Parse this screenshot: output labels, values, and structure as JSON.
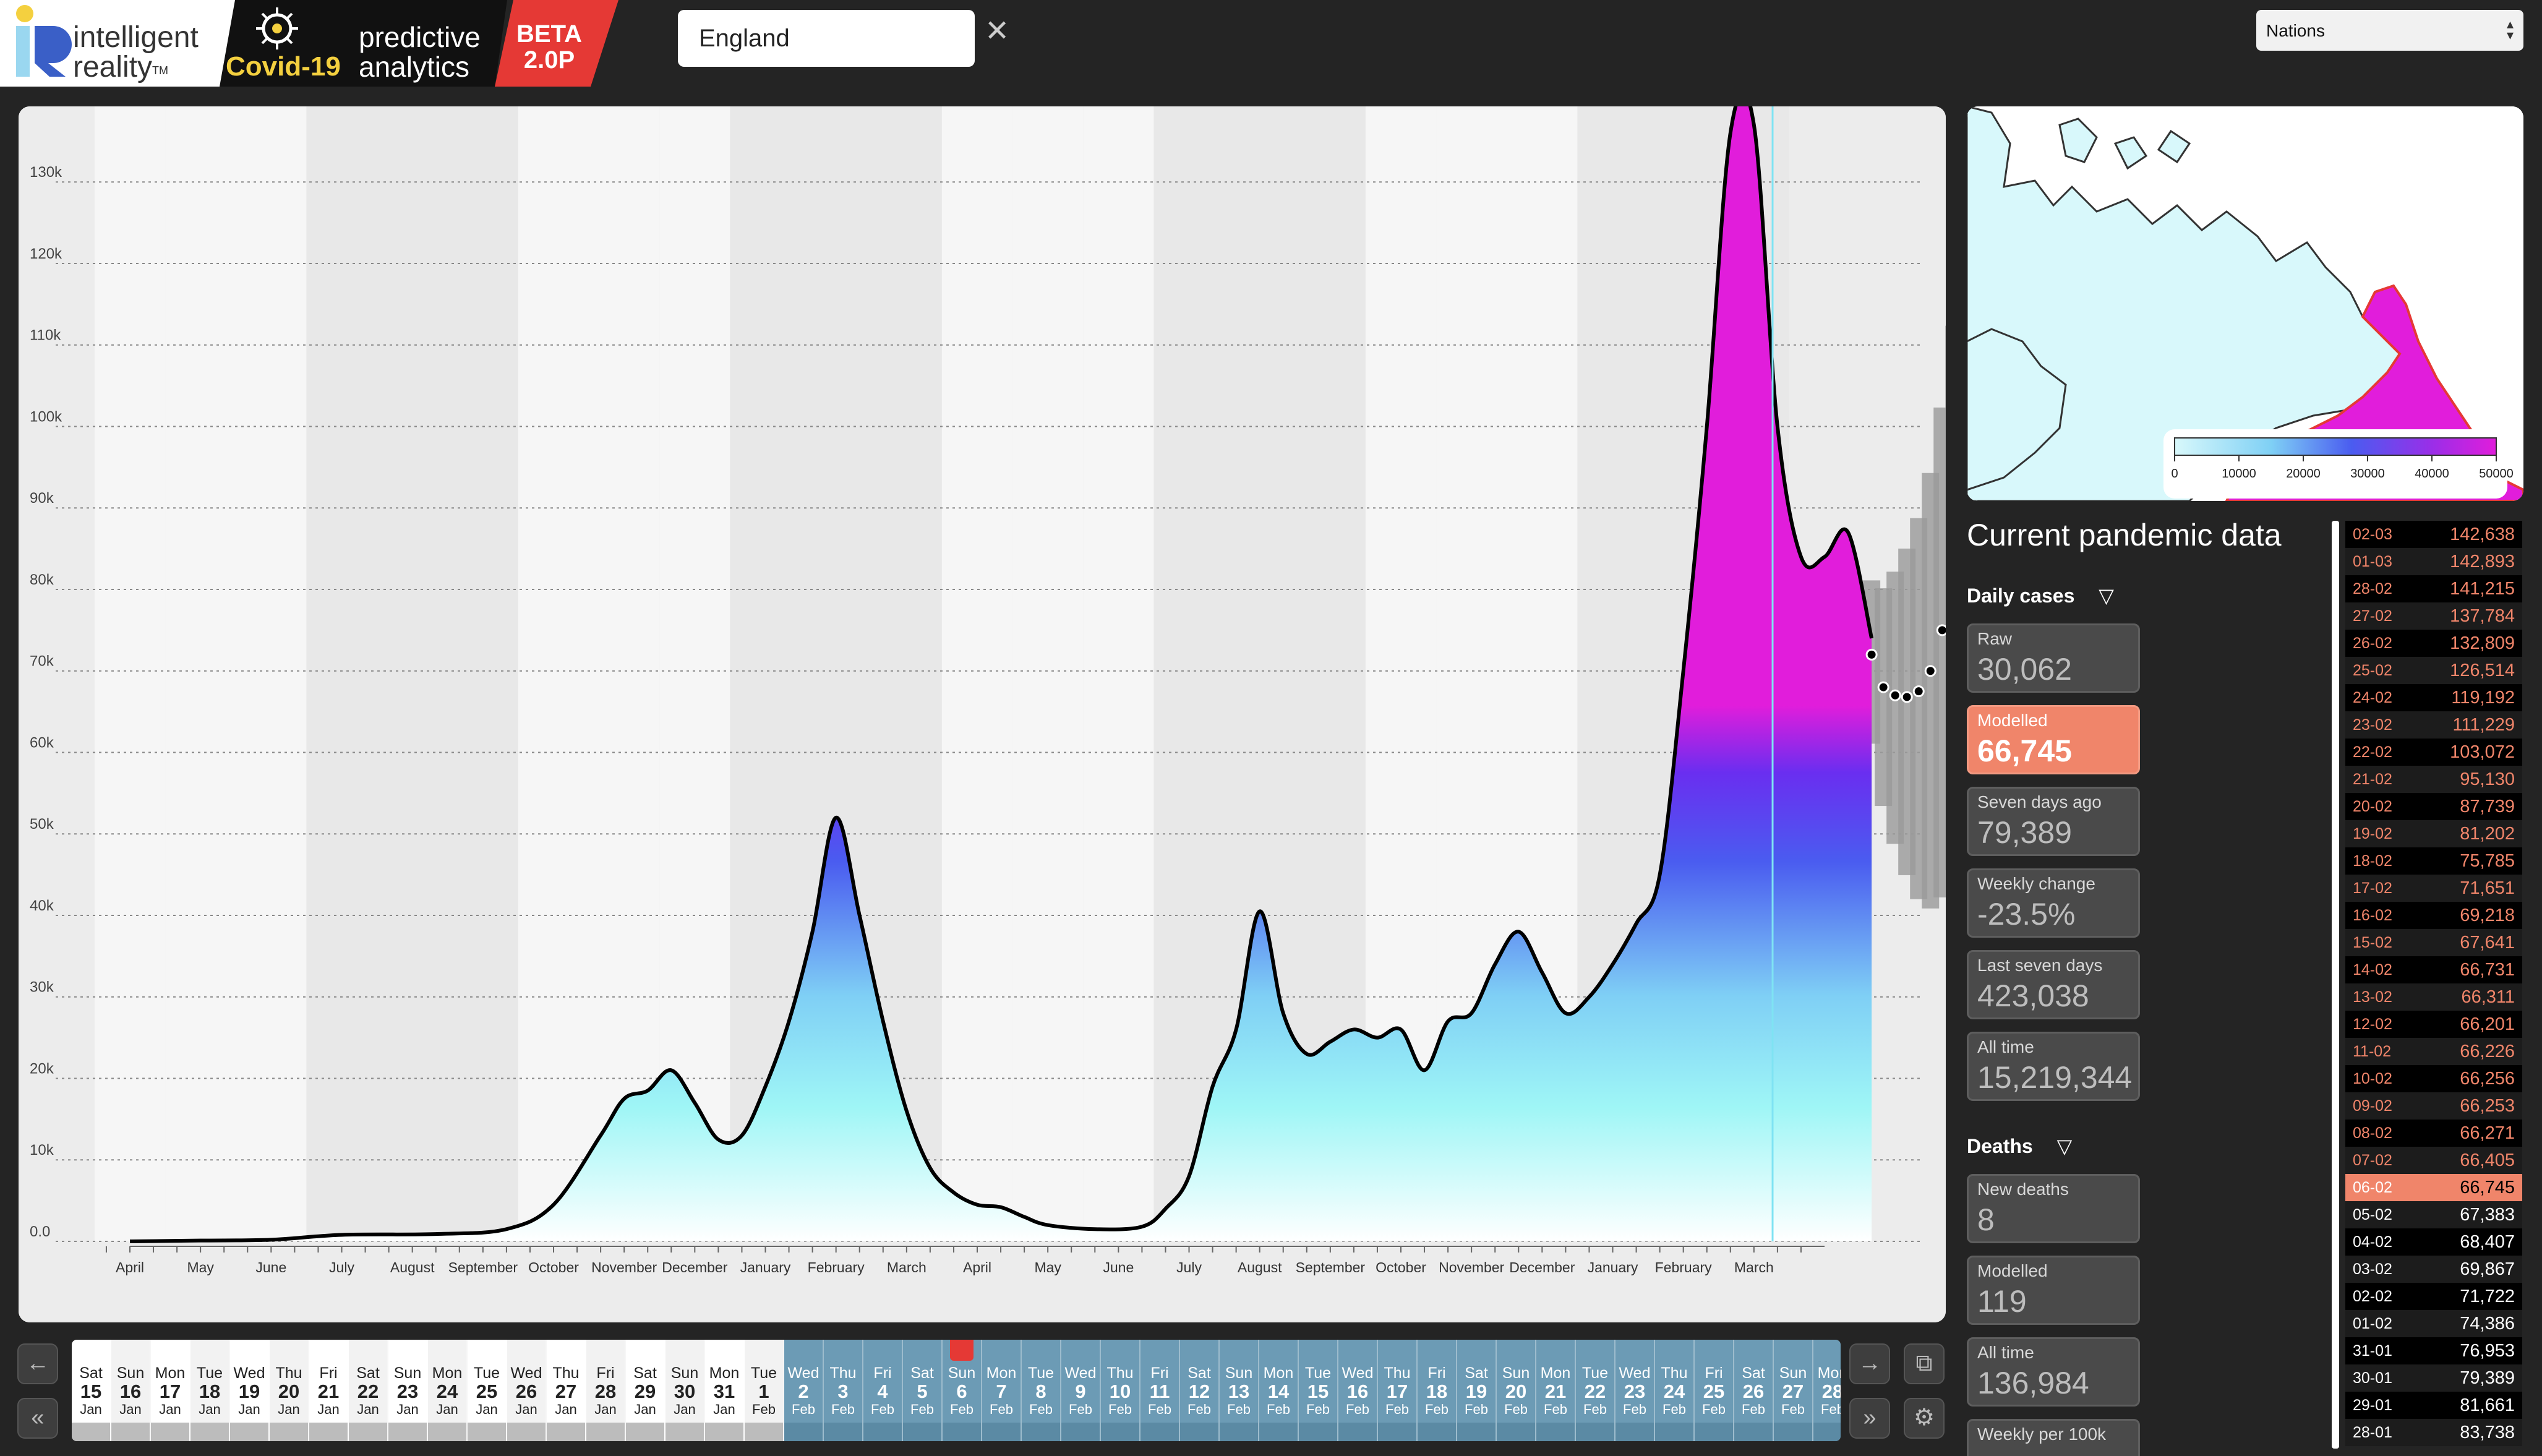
{
  "header": {
    "brand_line1": "intelligent",
    "brand_line2": "reality",
    "brand_tm": "TM",
    "covid_label": "Covid-19",
    "product_line1": "predictive",
    "product_line2": "analytics",
    "badge_line1": "BETA",
    "badge_line2": "2.0P",
    "search_value": "England",
    "clear_icon": "close-icon",
    "region_select": "Nations"
  },
  "colors": {
    "background": "#242424",
    "accent_red": "#e53935",
    "highlight": "#f0856a",
    "magenta": "#e11ddb",
    "purple": "#7a2ef0",
    "blue": "#4a5cf0",
    "cyan": "#9ff6f6"
  },
  "chart_data": {
    "type": "area",
    "ylim": [
      0,
      137000
    ],
    "y_ticks": [
      "0.0",
      "10k",
      "20k",
      "30k",
      "40k",
      "50k",
      "60k",
      "70k",
      "80k",
      "90k",
      "100k",
      "110k",
      "120k",
      "130k"
    ],
    "x_ticks": [
      "April",
      "May",
      "June",
      "July",
      "August",
      "September",
      "October",
      "November",
      "December",
      "January",
      "February",
      "March",
      "April",
      "May",
      "June",
      "July",
      "August",
      "September",
      "October",
      "November",
      "December",
      "January",
      "February",
      "March"
    ],
    "series": [
      {
        "values": [
          [
            0,
            0
          ],
          [
            3,
            100
          ],
          [
            6,
            200
          ],
          [
            9,
            800
          ],
          [
            13,
            900
          ],
          [
            16,
            1500
          ],
          [
            18,
            4500
          ],
          [
            20,
            13000
          ],
          [
            21,
            17500
          ],
          [
            22,
            18500
          ],
          [
            23,
            21000
          ],
          [
            24,
            17000
          ],
          [
            25,
            12500
          ],
          [
            26,
            13000
          ],
          [
            27,
            19000
          ],
          [
            28,
            27000
          ],
          [
            29,
            38000
          ],
          [
            30,
            52000
          ],
          [
            31,
            40000
          ],
          [
            32,
            27000
          ],
          [
            33,
            16000
          ],
          [
            34,
            9000
          ],
          [
            35,
            6000
          ],
          [
            36,
            4500
          ],
          [
            37,
            4200
          ],
          [
            38,
            3000
          ],
          [
            39,
            2000
          ],
          [
            41,
            1500
          ],
          [
            43,
            1800
          ],
          [
            44,
            4000
          ],
          [
            45,
            8000
          ],
          [
            46,
            19000
          ],
          [
            47,
            26000
          ],
          [
            48,
            40500
          ],
          [
            49,
            28000
          ],
          [
            50,
            23000
          ],
          [
            51,
            24500
          ],
          [
            52,
            26000
          ],
          [
            53,
            25000
          ],
          [
            54,
            26000
          ],
          [
            55,
            21000
          ],
          [
            56,
            27000
          ],
          [
            57,
            28000
          ],
          [
            58,
            34000
          ],
          [
            59,
            38000
          ],
          [
            60,
            33000
          ],
          [
            61,
            28000
          ],
          [
            62,
            30000
          ],
          [
            63,
            34000
          ],
          [
            64,
            39000
          ],
          [
            65,
            45000
          ],
          [
            66,
            70000
          ],
          [
            67,
            100000
          ],
          [
            68,
            136000
          ],
          [
            69,
            137000
          ],
          [
            70,
            100000
          ],
          [
            71,
            84000
          ],
          [
            72,
            84000
          ],
          [
            73,
            87000
          ],
          [
            74,
            74000
          ]
        ]
      },
      {
        "name": "forecast",
        "values": [
          [
            74,
            72000
          ],
          [
            74.5,
            68000
          ],
          [
            75,
            67000
          ],
          [
            75.5,
            66800
          ],
          [
            76,
            67500
          ],
          [
            76.5,
            70000
          ],
          [
            77,
            75000
          ],
          [
            77.5,
            82000
          ],
          [
            78,
            89000
          ],
          [
            78.5,
            96000
          ],
          [
            79,
            106000
          ],
          [
            79.5,
            116000
          ],
          [
            80,
            128000
          ],
          [
            80.5,
            137000
          ]
        ]
      }
    ]
  },
  "map": {
    "legend_ticks": [
      "0",
      "10000",
      "20000",
      "30000",
      "40000",
      "50000"
    ]
  },
  "stats": {
    "title": "Current pandemic data",
    "daily_cases": {
      "label": "Daily cases",
      "cards": [
        {
          "label": "Raw",
          "value": "30,062"
        },
        {
          "label": "Modelled",
          "value": "66,745"
        },
        {
          "label": "Seven days ago",
          "value": "79,389"
        },
        {
          "label": "Weekly change",
          "value": "-23.5%"
        },
        {
          "label": "Last seven days",
          "value": "423,038"
        },
        {
          "label": "All time",
          "value": "15,219,344"
        }
      ]
    },
    "deaths": {
      "label": "Deaths",
      "cards": [
        {
          "label": "New deaths",
          "value": "8"
        },
        {
          "label": "Modelled",
          "value": "119"
        },
        {
          "label": "All time",
          "value": "136,984"
        },
        {
          "label": "Weekly per 100k",
          "value": ""
        }
      ]
    }
  },
  "history": [
    {
      "date": "02-03",
      "value": "142,638"
    },
    {
      "date": "01-03",
      "value": "142,893"
    },
    {
      "date": "28-02",
      "value": "141,215"
    },
    {
      "date": "27-02",
      "value": "137,784"
    },
    {
      "date": "26-02",
      "value": "132,809"
    },
    {
      "date": "25-02",
      "value": "126,514"
    },
    {
      "date": "24-02",
      "value": "119,192"
    },
    {
      "date": "23-02",
      "value": "111,229"
    },
    {
      "date": "22-02",
      "value": "103,072"
    },
    {
      "date": "21-02",
      "value": "95,130"
    },
    {
      "date": "20-02",
      "value": "87,739"
    },
    {
      "date": "19-02",
      "value": "81,202"
    },
    {
      "date": "18-02",
      "value": "75,785"
    },
    {
      "date": "17-02",
      "value": "71,651"
    },
    {
      "date": "16-02",
      "value": "69,218"
    },
    {
      "date": "15-02",
      "value": "67,641"
    },
    {
      "date": "14-02",
      "value": "66,731"
    },
    {
      "date": "13-02",
      "value": "66,311"
    },
    {
      "date": "12-02",
      "value": "66,201"
    },
    {
      "date": "11-02",
      "value": "66,226"
    },
    {
      "date": "10-02",
      "value": "66,256"
    },
    {
      "date": "09-02",
      "value": "66,253"
    },
    {
      "date": "08-02",
      "value": "66,271"
    },
    {
      "date": "07-02",
      "value": "66,405"
    },
    {
      "date": "06-02",
      "value": "66,745"
    },
    {
      "date": "05-02",
      "value": "67,383"
    },
    {
      "date": "04-02",
      "value": "68,407"
    },
    {
      "date": "03-02",
      "value": "69,867"
    },
    {
      "date": "02-02",
      "value": "71,722"
    },
    {
      "date": "01-02",
      "value": "74,386"
    },
    {
      "date": "31-01",
      "value": "76,953"
    },
    {
      "date": "30-01",
      "value": "79,389"
    },
    {
      "date": "29-01",
      "value": "81,661"
    },
    {
      "date": "28-01",
      "value": "83,738"
    }
  ],
  "history_selected_date": "06-02",
  "timeline": {
    "days": [
      {
        "wd": "Sat",
        "d": "15",
        "m": "Jan"
      },
      {
        "wd": "Sun",
        "d": "16",
        "m": "Jan"
      },
      {
        "wd": "Mon",
        "d": "17",
        "m": "Jan"
      },
      {
        "wd": "Tue",
        "d": "18",
        "m": "Jan"
      },
      {
        "wd": "Wed",
        "d": "19",
        "m": "Jan"
      },
      {
        "wd": "Thu",
        "d": "20",
        "m": "Jan"
      },
      {
        "wd": "Fri",
        "d": "21",
        "m": "Jan"
      },
      {
        "wd": "Sat",
        "d": "22",
        "m": "Jan"
      },
      {
        "wd": "Sun",
        "d": "23",
        "m": "Jan"
      },
      {
        "wd": "Mon",
        "d": "24",
        "m": "Jan"
      },
      {
        "wd": "Tue",
        "d": "25",
        "m": "Jan"
      },
      {
        "wd": "Wed",
        "d": "26",
        "m": "Jan"
      },
      {
        "wd": "Thu",
        "d": "27",
        "m": "Jan"
      },
      {
        "wd": "Fri",
        "d": "28",
        "m": "Jan"
      },
      {
        "wd": "Sat",
        "d": "29",
        "m": "Jan"
      },
      {
        "wd": "Sun",
        "d": "30",
        "m": "Jan"
      },
      {
        "wd": "Mon",
        "d": "31",
        "m": "Jan"
      },
      {
        "wd": "Tue",
        "d": "1",
        "m": "Feb"
      },
      {
        "wd": "Wed",
        "d": "2",
        "m": "Feb"
      },
      {
        "wd": "Thu",
        "d": "3",
        "m": "Feb"
      },
      {
        "wd": "Fri",
        "d": "4",
        "m": "Feb"
      },
      {
        "wd": "Sat",
        "d": "5",
        "m": "Feb"
      },
      {
        "wd": "Sun",
        "d": "6",
        "m": "Feb"
      },
      {
        "wd": "Mon",
        "d": "7",
        "m": "Feb"
      },
      {
        "wd": "Tue",
        "d": "8",
        "m": "Feb"
      },
      {
        "wd": "Wed",
        "d": "9",
        "m": "Feb"
      },
      {
        "wd": "Thu",
        "d": "10",
        "m": "Feb"
      },
      {
        "wd": "Fri",
        "d": "11",
        "m": "Feb"
      },
      {
        "wd": "Sat",
        "d": "12",
        "m": "Feb"
      },
      {
        "wd": "Sun",
        "d": "13",
        "m": "Feb"
      },
      {
        "wd": "Mon",
        "d": "14",
        "m": "Feb"
      },
      {
        "wd": "Tue",
        "d": "15",
        "m": "Feb"
      },
      {
        "wd": "Wed",
        "d": "16",
        "m": "Feb"
      },
      {
        "wd": "Thu",
        "d": "17",
        "m": "Feb"
      },
      {
        "wd": "Fri",
        "d": "18",
        "m": "Feb"
      },
      {
        "wd": "Sat",
        "d": "19",
        "m": "Feb"
      },
      {
        "wd": "Sun",
        "d": "20",
        "m": "Feb"
      },
      {
        "wd": "Mon",
        "d": "21",
        "m": "Feb"
      },
      {
        "wd": "Tue",
        "d": "22",
        "m": "Feb"
      },
      {
        "wd": "Wed",
        "d": "23",
        "m": "Feb"
      },
      {
        "wd": "Thu",
        "d": "24",
        "m": "Feb"
      },
      {
        "wd": "Fri",
        "d": "25",
        "m": "Feb"
      },
      {
        "wd": "Sat",
        "d": "26",
        "m": "Feb"
      },
      {
        "wd": "Sun",
        "d": "27",
        "m": "Feb"
      },
      {
        "wd": "Mon",
        "d": "28",
        "m": "Feb"
      }
    ],
    "first_future_day": "2",
    "selected_day": "6",
    "nav_icons": [
      "arrow-left-icon",
      "double-arrow-left-icon",
      "arrow-right-icon",
      "double-arrow-right-icon",
      "popout-icon",
      "gear-icon"
    ]
  }
}
